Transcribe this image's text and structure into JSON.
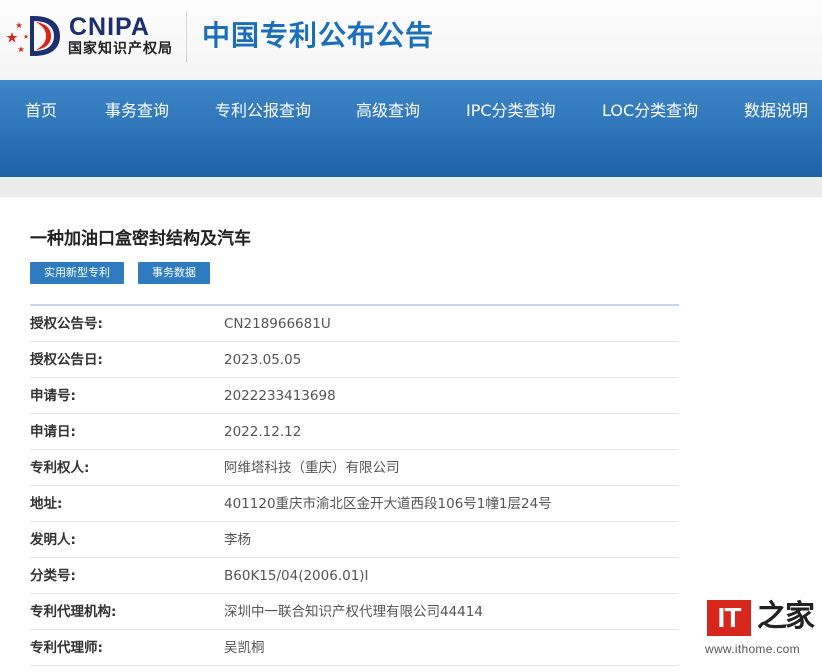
{
  "header": {
    "logo_en": "CNIPA",
    "logo_cn": "国家知识产权局",
    "site_title": "中国专利公布公告"
  },
  "nav": {
    "items": [
      "首页",
      "事务查询",
      "专利公报查询",
      "高级查询",
      "IPC分类查询",
      "LOC分类查询",
      "数据说明"
    ]
  },
  "patent": {
    "title": "一种加油口盒密封结构及汽车",
    "tags": [
      "实用新型专利",
      "事务数据"
    ],
    "fields": [
      {
        "label": "授权公告号:",
        "value": "CN218966681U"
      },
      {
        "label": "授权公告日:",
        "value": "2023.05.05"
      },
      {
        "label": "申请号:",
        "value": "2022233413698"
      },
      {
        "label": "申请日:",
        "value": "2022.12.12"
      },
      {
        "label": "专利权人:",
        "value": "阿维塔科技（重庆）有限公司"
      },
      {
        "label": "地址:",
        "value": "401120重庆市渝北区金开大道西段106号1幢1层24号"
      },
      {
        "label": "发明人:",
        "value": "李杨"
      },
      {
        "label": "分类号:",
        "value": "B60K15/04(2006.01)I"
      },
      {
        "label": "专利代理机构:",
        "value": "深圳中一联合知识产权代理有限公司44414"
      },
      {
        "label": "专利代理师:",
        "value": "吴凯桐"
      }
    ]
  },
  "watermark": {
    "badge": "IT",
    "cn": "之家",
    "url": "www.ithome.com"
  },
  "colors": {
    "nav_top": "#3f87c8",
    "nav_bottom": "#1e62aa",
    "title_blue": "#1a6fb8",
    "tag_blue": "#2e7cbf",
    "logo_navy": "#1c2f6e",
    "logo_red": "#d7261c"
  }
}
